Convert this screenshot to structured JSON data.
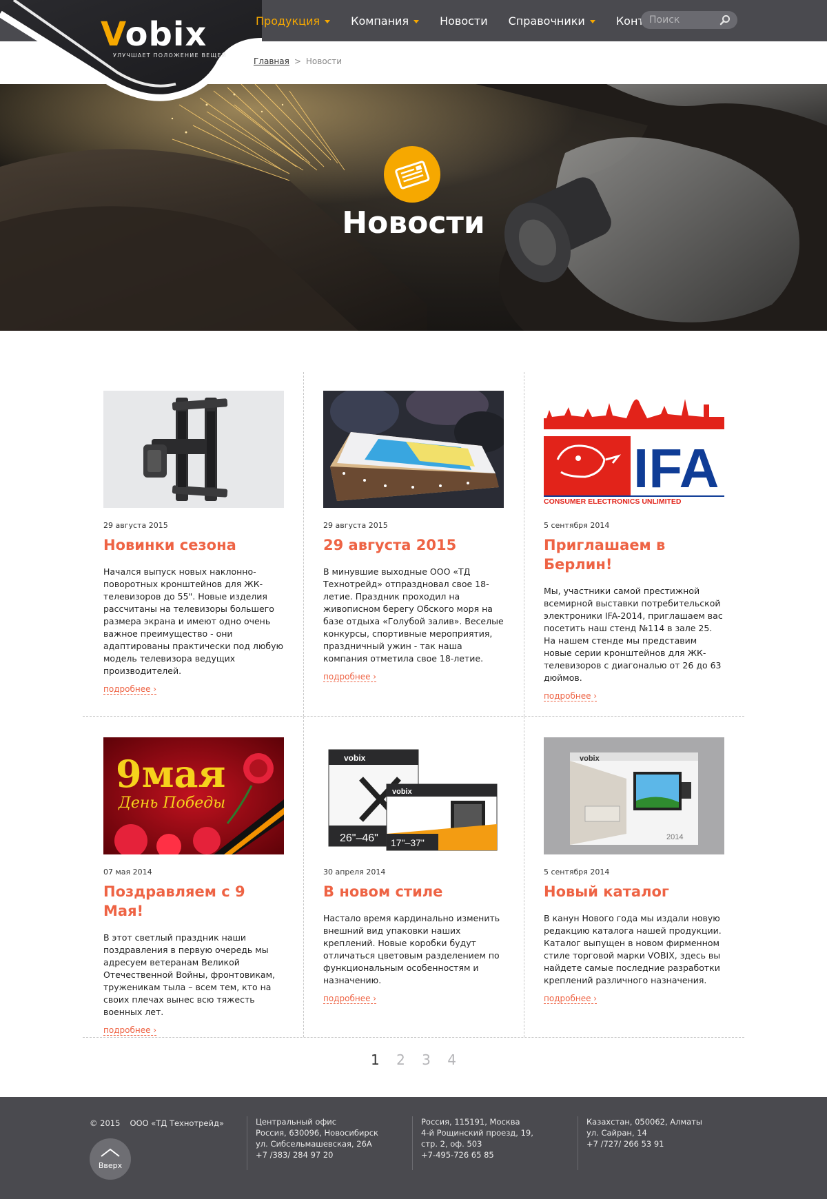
{
  "header": {
    "logo_text": "obix",
    "logo_letter": "V",
    "tagline": "УЛУЧШАЕТ ПОЛОЖЕНИЕ ВЕЩЕЙ",
    "nav": [
      {
        "label": "Продукция",
        "dropdown": true,
        "active": true
      },
      {
        "label": "Компания",
        "dropdown": true,
        "active": false
      },
      {
        "label": "Новости",
        "dropdown": false,
        "active": false
      },
      {
        "label": "Справочники",
        "dropdown": true,
        "active": false
      },
      {
        "label": "Контакты",
        "dropdown": true,
        "active": false
      }
    ],
    "search_placeholder": "Поиск",
    "accent_color": "#f6a800"
  },
  "breadcrumb": {
    "home": "Главная",
    "separator": ">",
    "current": "Новости"
  },
  "hero": {
    "title": "Новости",
    "icon": "newspaper-icon"
  },
  "news": [
    {
      "date": "29 августа 2015",
      "title": "Новинки сезона",
      "text": "Начался выпуск новых наклонно-поворотных кронштейнов для ЖК-телевизоров до 55\". Новые изделия рассчитаны на телевизоры большего размера экрана и имеют одно очень важное преимущество - они адаптированы практически под любую модель телевизора ведущих производителей.",
      "more": "подробнее ›",
      "image": "tv-bracket-image"
    },
    {
      "date": "29 августа 2015",
      "title": "29 августа 2015",
      "text": "В минувшие выходные ООО «ТД Технотрейд» отпраздновал свое 18-летие. Праздник проходил на живописном берегу Обского моря на базе отдыха «Голубой залив». Веселые конкурсы, спортивные мероприятия, праздничный ужин - так наша компания отметила свое 18-летие.",
      "more": "подробнее ›",
      "image": "birthday-cake-image"
    },
    {
      "date": "5 сентября 2014",
      "title": "Приглашаем в Берлин!",
      "text": "Мы, участники самой престижной всемирной выставки потребительской электроники IFA-2014, приглашаем вас посетить наш стенд №114 в зале 25. На нашем стенде мы представим новые серии кронштейнов для ЖК-телевизоров с диагональю от 26 до 63 дюймов.",
      "more": "подробнее ›",
      "image": "ifa-logo-image",
      "image_text": {
        "big": "IFA",
        "sub": "CONSUMER ELECTRONICS UNLIMITED"
      }
    },
    {
      "date": "07 мая 2014",
      "title": "Поздравляем с 9 Мая!",
      "text": "В этот светлый праздник наши поздравления в первую очередь мы адресуем ветеранам Великой Отечественной Войны, фронтовикам, труженикам тыла – всем тем, кто на своих плечах вынес всю тяжесть военных лет.",
      "more": "подробнее ›",
      "image": "may-9-image",
      "image_text": {
        "big": "9мая",
        "sub": "День Победы"
      }
    },
    {
      "date": "30 апреля 2014",
      "title": "В новом стиле",
      "text": "Настало время кардинально изменить внешний вид упаковки наших креплений. Новые коробки будут отличаться цветовым разделением по функциональным особенностям и назначению.",
      "more": "подробнее ›",
      "image": "packaging-boxes-image",
      "image_text": {
        "brand": "vobix",
        "size1": "26\"–46\"",
        "size2": "17\"–37\""
      }
    },
    {
      "date": "5 сентября 2014",
      "title": "Новый каталог",
      "text": "В канун Нового года мы издали новую редакцию каталога нашей продукции. Каталог выпущен в новом фирменном стиле торговой марки VOBIX, здесь вы найдете самые последние разработки креплений различного назначения.",
      "more": "подробнее ›",
      "image": "catalog-image",
      "image_text": {
        "brand": "vobix",
        "year": "2014"
      }
    }
  ],
  "pagination": [
    "1",
    "2",
    "3",
    "4"
  ],
  "pagination_current": "1",
  "footer": {
    "year": "© 2015",
    "company": "ООО «ТД Технотрейд»",
    "up_label": "Вверх",
    "offices": [
      {
        "lines": [
          "Центральный офис",
          "Россия, 630096, Новосибирск",
          "ул. Сибсельмашевская, 26А",
          "+7 /383/ 284 97 20"
        ]
      },
      {
        "lines": [
          "Россия, 115191, Москва",
          "4-й Рощинский проезд, 19,",
          "стр. 2, оф. 503",
          "+7-495-726 65 85"
        ]
      },
      {
        "lines": [
          "Казахстан, 050062, Алматы",
          "ул. Сайран, 14",
          "+7 /727/ 266 53 91"
        ]
      }
    ]
  },
  "colors": {
    "accent": "#f6a800",
    "link": "#ee6344",
    "header_bg": "#4a4a4f"
  }
}
